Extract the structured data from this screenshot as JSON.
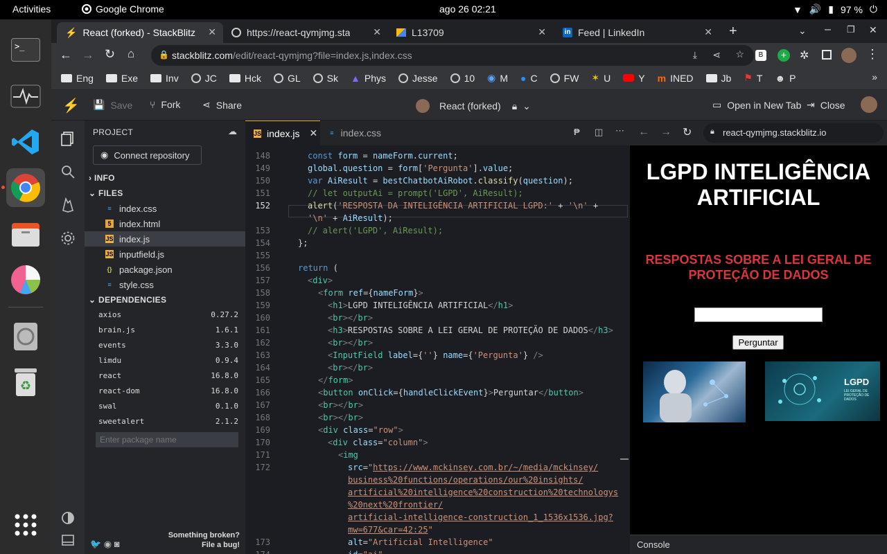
{
  "os": {
    "activities": "Activities",
    "app_name": "Google Chrome",
    "clock": "ago 26  02:21",
    "battery": "97 %"
  },
  "tabs": [
    {
      "title": "React (forked) - StackBlitz"
    },
    {
      "title": "https://react-qymjmg.sta"
    },
    {
      "title": "L13709"
    },
    {
      "title": "Feed | LinkedIn"
    }
  ],
  "address": {
    "host": "stackblitz.com",
    "path": "/edit/react-qymjmg?file=index.js,index.css"
  },
  "bookmarks": [
    "Eng",
    "Exe",
    "Inv",
    "JC",
    "Hck",
    "GL",
    "Sk",
    "Phys",
    "Jesse",
    "10",
    "M",
    "C",
    "FW",
    "U",
    "Y",
    "INED",
    "Jb",
    "T",
    "P"
  ],
  "sb": {
    "save": "Save",
    "fork": "Fork",
    "share": "Share",
    "project_title": "React (forked)",
    "open_new_tab": "Open in New Tab",
    "close": "Close"
  },
  "sidebar": {
    "project": "PROJECT",
    "connect": "Connect repository",
    "info": "INFO",
    "files": "FILES",
    "dependencies": "DEPENDENCIES",
    "package_placeholder": "Enter package name",
    "broken1": "Something broken?",
    "broken2": "File a bug!",
    "file_list": [
      {
        "name": "index.css",
        "type": "css"
      },
      {
        "name": "index.html",
        "type": "html"
      },
      {
        "name": "index.js",
        "type": "js"
      },
      {
        "name": "inputfield.js",
        "type": "js"
      },
      {
        "name": "package.json",
        "type": "json"
      },
      {
        "name": "style.css",
        "type": "css"
      }
    ],
    "deps": [
      {
        "name": "axios",
        "ver": "0.27.2"
      },
      {
        "name": "brain.js",
        "ver": "1.6.1"
      },
      {
        "name": "events",
        "ver": "3.3.0"
      },
      {
        "name": "limdu",
        "ver": "0.9.4"
      },
      {
        "name": "react",
        "ver": "16.8.0"
      },
      {
        "name": "react-dom",
        "ver": "16.8.0"
      },
      {
        "name": "swal",
        "ver": "0.1.0"
      },
      {
        "name": "sweetalert",
        "ver": "2.1.2"
      }
    ]
  },
  "editor": {
    "tab1": "index.js",
    "tab2": "index.css"
  },
  "preview": {
    "url": "react-qymjmg.stackblitz.io",
    "h1": "LGPD INTELIGÊNCIA ARTIFICIAL",
    "h3": "RESPOSTAS SOBRE A LEI GERAL DE PROTEÇÃO DE DADOS",
    "button": "Perguntar",
    "img2_title": "LGPD",
    "img2_sub": "LEI GERAL DE PROTEÇÃO DE DADOS",
    "console": "Console"
  },
  "colors": {
    "accent": "#1389fd",
    "heading_red": "#d9363e"
  }
}
